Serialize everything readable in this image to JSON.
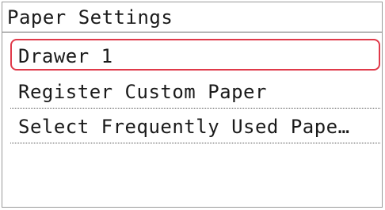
{
  "title": "Paper Settings",
  "menu": {
    "items": [
      {
        "label": "Drawer 1",
        "selected": true
      },
      {
        "label": "Register Custom Paper",
        "selected": false
      },
      {
        "label": "Select Frequently Used Pape…",
        "selected": false
      }
    ]
  },
  "colors": {
    "selection_border": "#e03a4a",
    "text": "#1a1a1a",
    "background": "#ffffff"
  }
}
